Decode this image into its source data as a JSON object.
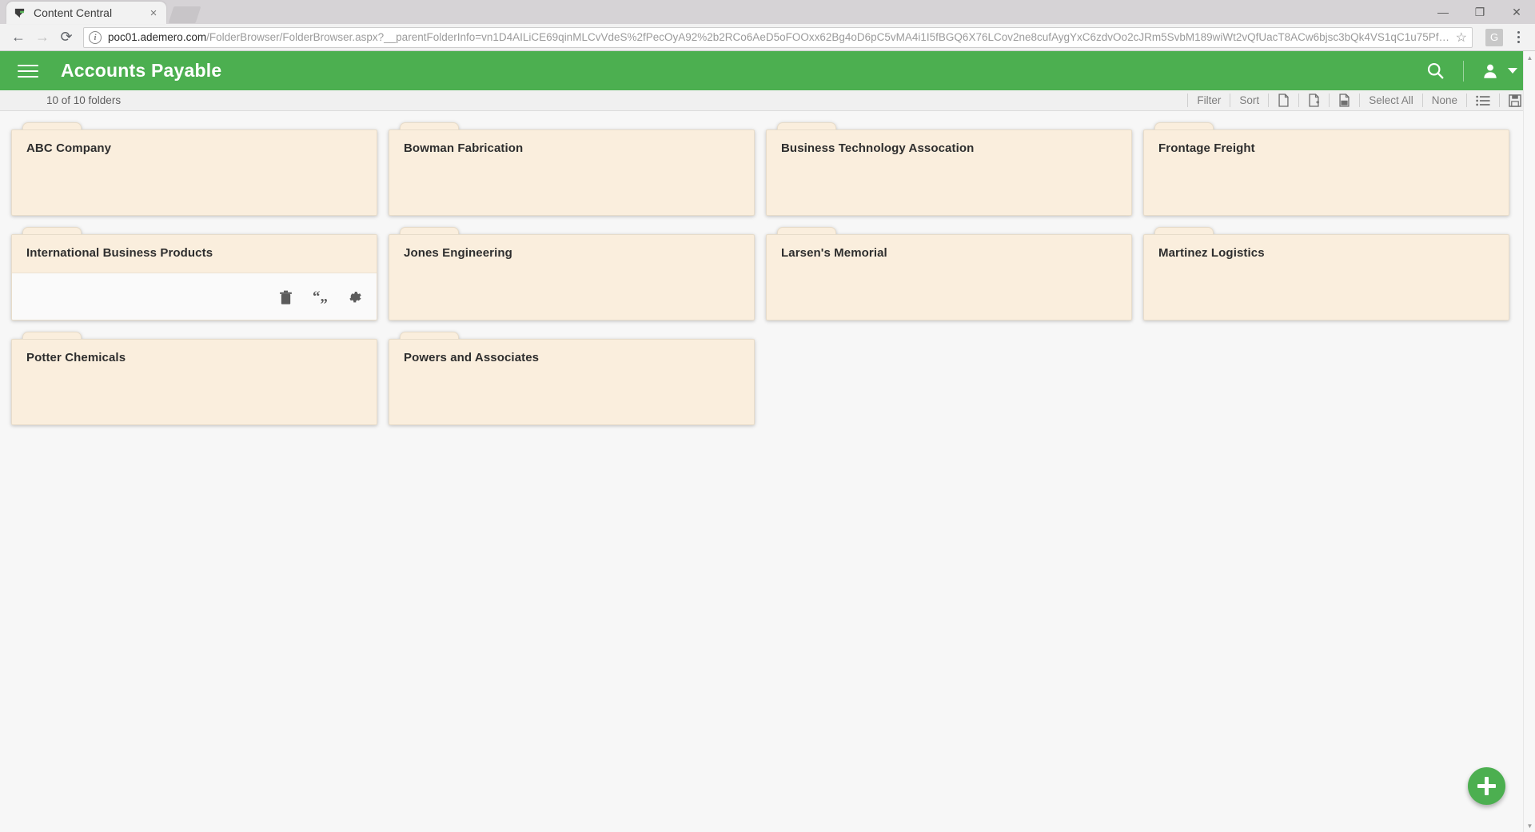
{
  "browser": {
    "tab": {
      "title": "Content Central",
      "favicon_icon": "content-central-logo-icon",
      "close_icon": "×"
    },
    "new_tab_icon": "new-tab-icon",
    "window_controls": {
      "minimize": "—",
      "maximize": "❐",
      "close": "✕"
    },
    "nav": {
      "back": "←",
      "forward": "→",
      "reload": "⟳"
    },
    "omnibox": {
      "info_icon": "i",
      "url_domain": "poc01.ademero.com",
      "url_path": "/FolderBrowser/FolderBrowser.aspx?__parentFolderInfo=vn1D4AILiCE69qinMLCvVdeS%2fPecOyA92%2b2RCo6AeD5oFOOxx62Bg4oD6pC5vMA4i1I5fBGQ6X76LCov2ne8cufAygYxC6zdvOo2cJRm5SvbM189wiWt2vQfUacT8ACw6bjsc3bQk4VS1qC1u75PfGrXY...",
      "star_icon": "☆"
    },
    "extension_badge": "G",
    "menu_icon": "three-dot-menu-icon"
  },
  "app": {
    "header": {
      "menu_icon": "hamburger-menu-icon",
      "title": "Accounts Payable",
      "search_icon": "search-icon",
      "user_icon": "user-account-icon",
      "user_caret_icon": "chevron-down-icon",
      "accent_color": "#4caf50"
    },
    "subtoolbar": {
      "count_label": "10 of 10 folders",
      "filter_label": "Filter",
      "sort_label": "Sort",
      "icon_new_document": "new-document-icon",
      "icon_import_document": "import-document-icon",
      "icon_document_properties": "document-properties-icon",
      "select_all_label": "Select All",
      "none_label": "None",
      "icon_list_view": "list-view-icon",
      "icon_grid_view": "grid-view-icon"
    },
    "folders": [
      {
        "name": "ABC Company",
        "hovered": false
      },
      {
        "name": "Bowman Fabrication",
        "hovered": false
      },
      {
        "name": "Business Technology Assocation",
        "hovered": false
      },
      {
        "name": "Frontage Freight",
        "hovered": false
      },
      {
        "name": "International Business Products",
        "hovered": true
      },
      {
        "name": "Jones Engineering",
        "hovered": false
      },
      {
        "name": "Larsen's Memorial",
        "hovered": false
      },
      {
        "name": "Martinez Logistics",
        "hovered": false
      },
      {
        "name": "Potter Chemicals",
        "hovered": false
      },
      {
        "name": "Powers and Associates",
        "hovered": false
      }
    ],
    "folder_actions": {
      "delete_icon": "trash-icon",
      "rename_icon": "quote-rename-icon",
      "settings_icon": "gear-icon"
    },
    "fab": {
      "icon": "plus-icon",
      "color": "#4caf50"
    },
    "folder_colors": {
      "fill": "#faeedd",
      "border": "#e7dcca",
      "hover_fill": "#fafafa"
    }
  }
}
